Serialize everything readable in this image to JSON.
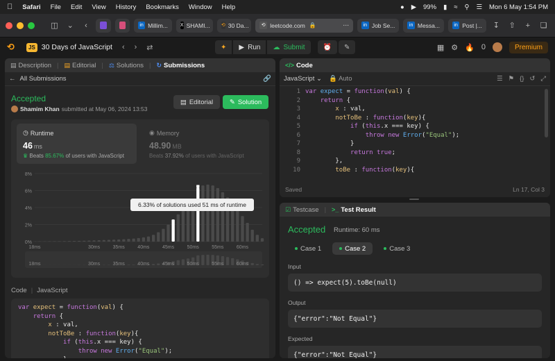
{
  "menubar": {
    "app": "Safari",
    "items": [
      "File",
      "Edit",
      "View",
      "History",
      "Bookmarks",
      "Window",
      "Help"
    ],
    "battery": "99%",
    "clock": "Mon 6 May  1:54 PM"
  },
  "browser": {
    "tabs": [
      {
        "label": "Millim...",
        "favicon": "linkedin-icon",
        "color": "#0a66c2"
      },
      {
        "label": "SHAMI...",
        "favicon": "x-icon",
        "color": "#000000"
      },
      {
        "label": "30 Da...",
        "favicon": "leetcode-icon",
        "color": "#ffa116"
      }
    ],
    "url": "leetcode.com",
    "right_tabs": [
      {
        "label": "Job Se...",
        "favicon": "linkedin-icon",
        "color": "#0a66c2"
      },
      {
        "label": "Messa...",
        "favicon": "linkedin-icon",
        "color": "#0a66c2"
      },
      {
        "label": "Post |...",
        "favicon": "linkedin-icon",
        "color": "#0a66c2"
      }
    ]
  },
  "lcnav": {
    "badge": "JS",
    "title": "30 Days of JavaScript",
    "run": "Run",
    "submit": "Submit",
    "streak": "0",
    "premium": "Premium"
  },
  "left": {
    "tabs": [
      "Description",
      "Editorial",
      "Solutions",
      "Submissions"
    ],
    "all_submissions": "All Submissions",
    "status": "Accepted",
    "user": "Shamim Khan",
    "submitted_text": "submitted at May 06, 2024 13:53",
    "editorial_btn": "Editorial",
    "solution_btn": "Solution",
    "runtime": {
      "label": "Runtime",
      "value": "46",
      "unit": "ms",
      "beats_prefix": "Beats",
      "beats_pct": "85.67%",
      "beats_suffix": "of users with JavaScript"
    },
    "memory": {
      "label": "Memory",
      "value": "48.90",
      "unit": "MB",
      "beats_prefix": "Beats",
      "beats_pct": "37.92%",
      "beats_suffix": "of users with JavaScript"
    },
    "code_label": "Code",
    "code_lang": "JavaScript"
  },
  "chart_data": {
    "type": "bar",
    "x": [
      18,
      19,
      20,
      21,
      22,
      23,
      24,
      25,
      26,
      27,
      28,
      29,
      30,
      31,
      32,
      33,
      34,
      35,
      36,
      37,
      38,
      39,
      40,
      41,
      42,
      43,
      44,
      45,
      46,
      47,
      48,
      49,
      50,
      51,
      52,
      53,
      54,
      55,
      56,
      57,
      58,
      59,
      60,
      61,
      62,
      63,
      64
    ],
    "values": [
      0.02,
      0.03,
      0.03,
      0.04,
      0.05,
      0.05,
      0.06,
      0.07,
      0.08,
      0.09,
      0.1,
      0.12,
      0.14,
      0.16,
      0.18,
      0.2,
      0.22,
      0.25,
      0.28,
      0.32,
      0.36,
      0.42,
      0.5,
      0.6,
      0.8,
      1.1,
      1.5,
      2.0,
      2.6,
      3.2,
      3.8,
      4.3,
      5.0,
      6.33,
      6.6,
      6.7,
      6.6,
      6.3,
      5.8,
      5.2,
      4.5,
      3.8,
      3.0,
      2.2,
      1.4,
      0.8,
      0.4
    ],
    "highlight_x": [
      46,
      51
    ],
    "yticks": [
      "0%",
      "2%",
      "4%",
      "6%",
      "8%"
    ],
    "ylim": [
      0,
      8
    ],
    "xticks": [
      "18ms",
      "30ms",
      "35ms",
      "40ms",
      "45ms",
      "50ms",
      "55ms",
      "60ms"
    ],
    "tooltip": "6.33% of solutions used 51 ms of runtime",
    "grid": true
  },
  "code_panel": {
    "title": "Code",
    "lang": "JavaScript",
    "mode": "Auto",
    "status": "Saved",
    "cursor": "Ln 17, Col 3",
    "line_numbers": [
      "1",
      "2",
      "3",
      "4",
      "5",
      "6",
      "7",
      "8",
      "9",
      "10"
    ]
  },
  "test": {
    "tab1": "Testcase",
    "tab2": "Test Result",
    "status": "Accepted",
    "runtime": "Runtime: 60 ms",
    "cases": [
      "Case 1",
      "Case 2",
      "Case 3"
    ],
    "input_label": "Input",
    "input": "() => expect(5).toBe(null)",
    "output_label": "Output",
    "output": "{\"error\":\"Not Equal\"}",
    "expected_label": "Expected",
    "expected": "{\"error\":\"Not Equal\"}"
  }
}
